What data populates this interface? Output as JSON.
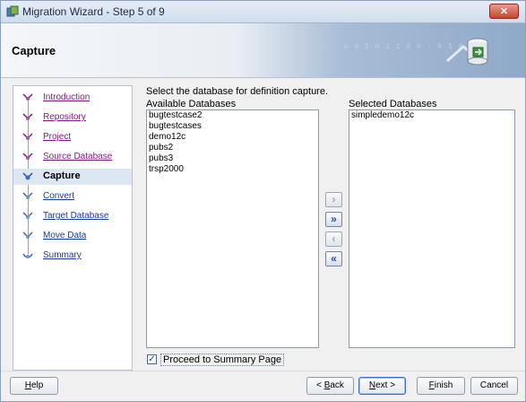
{
  "window": {
    "title": "Migration Wizard - Step 5 of 9",
    "close_label": "✕"
  },
  "header": {
    "title": "Capture",
    "dots": "· · ·  o 0 1 0 1 1 0 0 · 0 1 0 1 ·"
  },
  "nav": {
    "items": [
      {
        "label": "Introduction",
        "state": "visited"
      },
      {
        "label": "Repository",
        "state": "visited"
      },
      {
        "label": "Project",
        "state": "visited"
      },
      {
        "label": "Source Database",
        "state": "visited"
      },
      {
        "label": "Capture",
        "state": "active"
      },
      {
        "label": "Convert",
        "state": "pending"
      },
      {
        "label": "Target Database",
        "state": "pending"
      },
      {
        "label": "Move Data",
        "state": "pending"
      },
      {
        "label": "Summary",
        "state": "pending"
      }
    ]
  },
  "main": {
    "instruction": "Select the database for definition capture.",
    "available_label": "Available Databases",
    "selected_label": "Selected Databases",
    "available": [
      "bugtestcase2",
      "bugtestcases",
      "demo12c",
      "pubs2",
      "pubs3",
      "trsp2000"
    ],
    "selected": [
      "simpledemo12c"
    ],
    "move_buttons": {
      "add_one": "›",
      "add_all": "»",
      "remove_one": "‹",
      "remove_all": "«"
    },
    "proceed_checkbox": {
      "label": "Proceed to Summary Page",
      "checked": true,
      "mark": "✓"
    }
  },
  "footer": {
    "help": {
      "u": "H",
      "rest": "elp"
    },
    "back": {
      "pre": "< ",
      "u": "B",
      "rest": "ack"
    },
    "next": {
      "u": "N",
      "rest": "ext >"
    },
    "finish": {
      "u": "F",
      "rest": "inish"
    },
    "cancel": "Cancel"
  },
  "colors": {
    "title_bar": "#cfdcec",
    "close_button": "#c64632",
    "link": "#1a3a9e",
    "visited_link": "#7a1a7a",
    "active_step_bg": "#dde6f3"
  },
  "icons": {
    "app": "migration-wizard-icon",
    "header_art": "database-icon",
    "nav_visited": "completed-step-icon",
    "nav_active": "current-step-icon",
    "nav_pending": "pending-step-icon"
  }
}
